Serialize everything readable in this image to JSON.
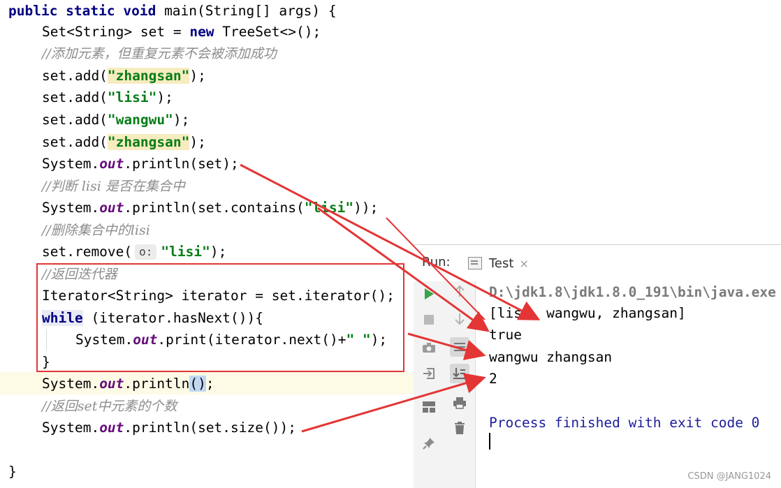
{
  "code": {
    "line1_kw": "public static void",
    "line1_rest": " main(String[] args) {",
    "line2_pre": "Set<String> set = ",
    "line2_kw": "new",
    "line2_post": " TreeSet<>();",
    "comment1": "//添加元素，但重复元素不会被添加成功",
    "add_prefix": "set.add(",
    "add_suffix": ");",
    "str_zhangsan": "\"zhangsan\"",
    "str_lisi": "\"lisi\"",
    "str_wangwu": "\"wangwu\"",
    "sys": "System.",
    "out": "out",
    "println_set": ".println(set);",
    "comment2": "//判断 lisi 是否在集合中",
    "println_contains_pre": ".println(set.contains(",
    "println_contains_post": "));",
    "comment3": "//删除集合中的lisi",
    "remove_pre": "set.remove(",
    "hint_o": "o:",
    "remove_post": ");",
    "comment4": "//返回迭代器",
    "iter_line": "Iterator<String> iterator = set.iterator();",
    "while_kw": "while",
    "while_rest": " (iterator.hasNext()){",
    "print_pre": ".print(iterator.next()+",
    "space_str": "\" \"",
    "print_post": ");",
    "close_brace": "}",
    "println_empty_pre": ".println",
    "println_empty_paren": "()",
    "println_empty_post": ";",
    "comment5": "//返回set中元素的个数",
    "println_size": ".println(set.size());",
    "final_brace": "}"
  },
  "run_panel": {
    "label": "Run:",
    "tab_name": "Test",
    "tab_close": "×",
    "output": [
      "D:\\jdk1.8\\jdk1.8.0_191\\bin\\java.exe",
      "[lisi, wangwu, zhangsan]",
      "true",
      "wangwu zhangsan",
      "2",
      "",
      "Process finished with exit code 0"
    ],
    "toolbar_icons": [
      "run-icon",
      "stop-icon",
      "camera-icon",
      "exit-icon",
      "layout-icon",
      "pin-icon",
      "up-arrow-icon",
      "down-arrow-icon",
      "soft-wrap-icon",
      "scroll-to-end-icon",
      "print-icon",
      "trash-icon"
    ]
  },
  "watermark": "CSDN @JANG1024",
  "colors": {
    "annotation_red": "#e33535",
    "keyword": "#000080",
    "string": "#067d17",
    "field": "#660e7a",
    "comment": "#8c8c8c",
    "exit_text": "#1d1d9b"
  }
}
